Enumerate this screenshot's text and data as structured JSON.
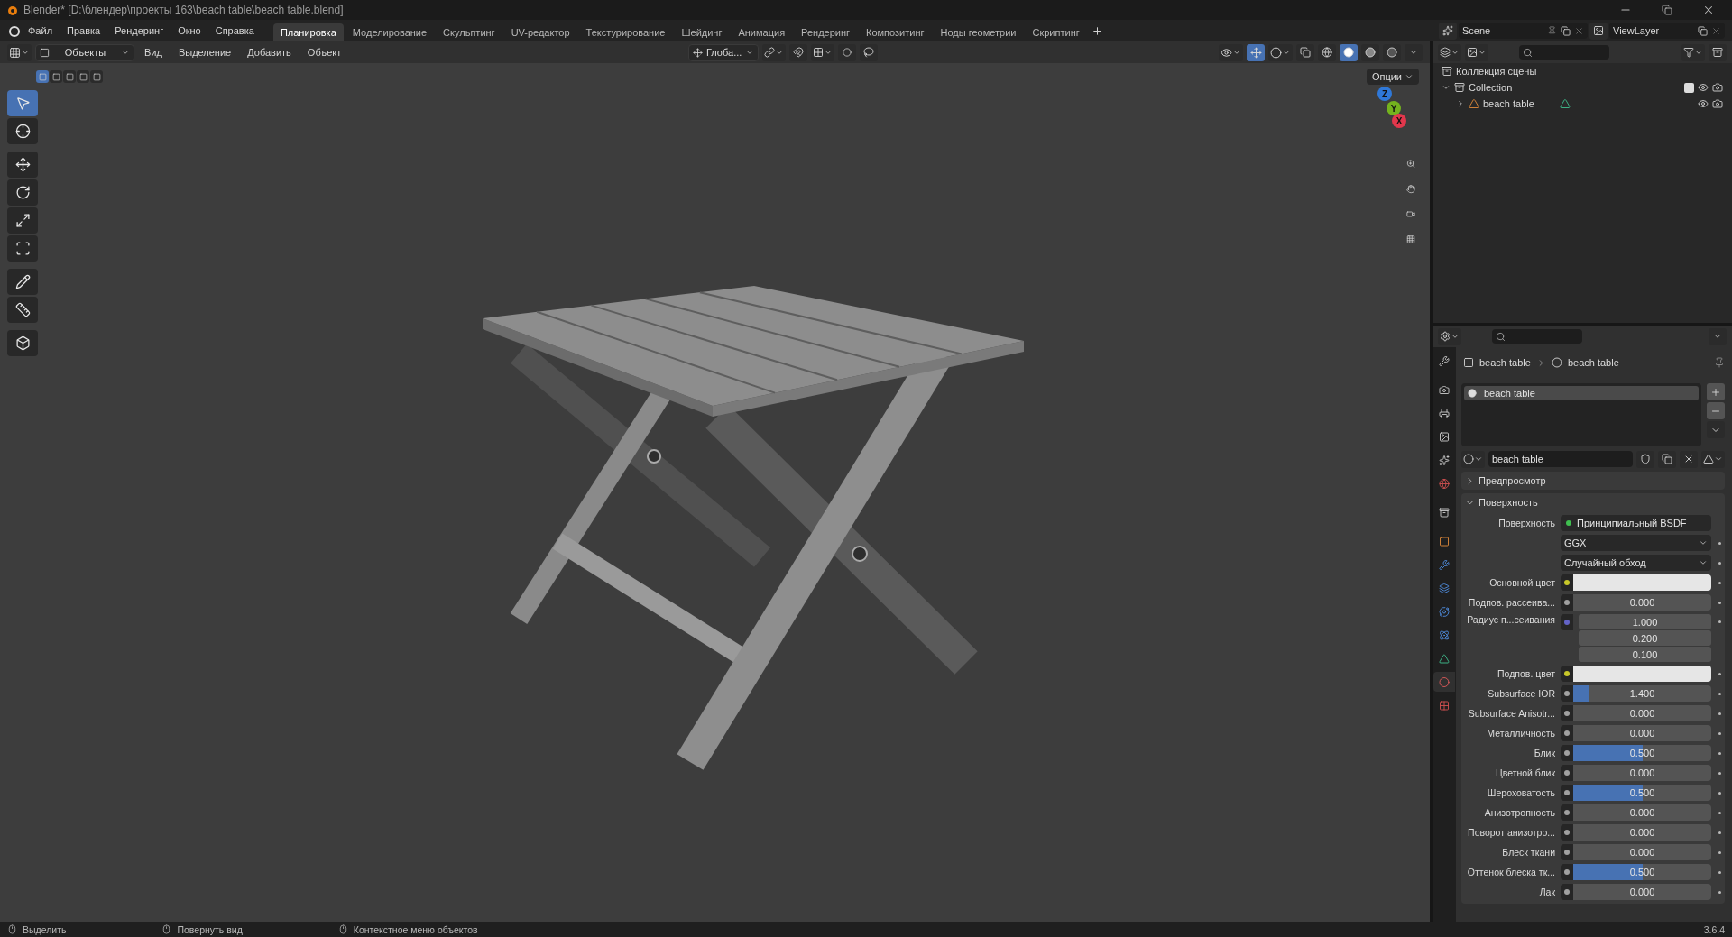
{
  "window": {
    "title": "Blender* [D:\\блендер\\проекты 163\\beach table\\beach table.blend]"
  },
  "menu": [
    "Файл",
    "Правка",
    "Рендеринг",
    "Окно",
    "Справка"
  ],
  "workspaces": [
    {
      "label": "Планировка",
      "selected": true
    },
    {
      "label": "Моделирование",
      "selected": false
    },
    {
      "label": "Скульптинг",
      "selected": false
    },
    {
      "label": "UV-редактор",
      "selected": false
    },
    {
      "label": "Текстурирование",
      "selected": false
    },
    {
      "label": "Шейдинг",
      "selected": false
    },
    {
      "label": "Анимация",
      "selected": false
    },
    {
      "label": "Рендеринг",
      "selected": false
    },
    {
      "label": "Композитинг",
      "selected": false
    },
    {
      "label": "Ноды геометрии",
      "selected": false
    },
    {
      "label": "Скриптинг",
      "selected": false
    }
  ],
  "scene": {
    "name": "Scene",
    "view_layer": "ViewLayer"
  },
  "viewport": {
    "mode": "Объекты",
    "menus": [
      "Вид",
      "Выделение",
      "Добавить",
      "Объект"
    ],
    "orientation": "Глоба...",
    "options": "Опции",
    "gizmo_on": true,
    "select_modes": [
      {
        "selected": true
      },
      {
        "selected": false
      },
      {
        "selected": false
      },
      {
        "selected": false
      },
      {
        "selected": false
      }
    ],
    "shading": [
      {
        "kind": "wireframe",
        "selected": false
      },
      {
        "kind": "solid",
        "selected": true
      },
      {
        "kind": "material",
        "selected": false
      },
      {
        "kind": "rendered",
        "selected": false
      }
    ],
    "tools": [
      {
        "kind": "select",
        "selected": true
      },
      {
        "kind": "cursor",
        "selected": false
      },
      {
        "kind": "move",
        "selected": false
      },
      {
        "kind": "rotate",
        "selected": false
      },
      {
        "kind": "scale",
        "selected": false
      },
      {
        "kind": "transform",
        "selected": false
      },
      {
        "kind": "annotate",
        "selected": false
      },
      {
        "kind": "measure",
        "selected": false
      },
      {
        "kind": "add_cube",
        "selected": false
      }
    ],
    "axes": [
      {
        "label": "Z",
        "color": "#2f78d8"
      },
      {
        "label": "Y",
        "color": "#74b21e"
      },
      {
        "label": "X",
        "color": "#e2374c"
      }
    ]
  },
  "outliner": {
    "root": "Коллекция сцены",
    "children": [
      {
        "label": "Collection",
        "expanded": true,
        "checked": true,
        "children": [
          {
            "label": "beach table",
            "expanded": false
          }
        ]
      }
    ]
  },
  "properties": {
    "breadcrumb": [
      "beach table",
      "beach table"
    ],
    "tabs": [
      {
        "kind": "tool",
        "selected": false
      },
      {
        "kind": "render",
        "selected": false
      },
      {
        "kind": "output",
        "selected": false
      },
      {
        "kind": "view_layer",
        "selected": false
      },
      {
        "kind": "scene",
        "selected": false
      },
      {
        "kind": "world",
        "selected": false
      },
      {
        "kind": "collection",
        "selected": false
      },
      {
        "kind": "object",
        "selected": false
      },
      {
        "kind": "modifiers",
        "selected": false
      },
      {
        "kind": "particles",
        "selected": false
      },
      {
        "kind": "physics",
        "selected": false
      },
      {
        "kind": "constraints",
        "selected": false
      },
      {
        "kind": "data",
        "selected": false
      },
      {
        "kind": "material",
        "selected": true
      },
      {
        "kind": "texture",
        "selected": false
      }
    ],
    "slots": [
      {
        "label": "beach table",
        "selected": true
      }
    ],
    "material_name": "beach table",
    "panels": [
      {
        "label": "Предпросмотр",
        "expanded": false
      },
      {
        "label": "Поверхность",
        "expanded": true
      }
    ],
    "fields": [
      {
        "kind": "shader",
        "label": "Поверхность",
        "value": "Принципиальный BSDF",
        "socket": {
          "color": "#3fbf4f"
        }
      },
      {
        "kind": "dropdown",
        "value": "GGX"
      },
      {
        "kind": "dropdown",
        "value": "Случайный обход"
      },
      {
        "kind": "color",
        "label": "Основной цвет",
        "color": "#e6e6e6",
        "socket": {
          "color": "#c8c82a"
        }
      },
      {
        "kind": "slider",
        "label": "Подпов. рассеива...",
        "value": "0.000",
        "level": 0,
        "socket": {
          "color": "#a1a1a1"
        }
      },
      {
        "kind": "vector",
        "label": "Радиус п...сеивания",
        "values": [
          "1.000",
          "0.200",
          "0.100"
        ],
        "socket": {
          "color": "#6363c7"
        }
      },
      {
        "kind": "color",
        "label": "Подпов. цвет",
        "color": "#e6e6e6",
        "socket": {
          "color": "#c8c82a"
        }
      },
      {
        "kind": "slider",
        "label": "Subsurface IOR",
        "value": "1.400",
        "level": 0.12,
        "socket": {
          "color": "#a1a1a1"
        }
      },
      {
        "kind": "slider",
        "label": "Subsurface Anisotr...",
        "value": "0.000",
        "level": 0,
        "socket": {
          "color": "#a1a1a1"
        }
      },
      {
        "kind": "slider",
        "label": "Металличность",
        "value": "0.000",
        "level": 0,
        "socket": {
          "color": "#a1a1a1"
        }
      },
      {
        "kind": "slider",
        "label": "Блик",
        "value": "0.500",
        "level": 0.5,
        "socket": {
          "color": "#a1a1a1"
        }
      },
      {
        "kind": "slider",
        "label": "Цветной блик",
        "value": "0.000",
        "level": 0,
        "socket": {
          "color": "#a1a1a1"
        }
      },
      {
        "kind": "slider",
        "label": "Шероховатость",
        "value": "0.500",
        "level": 0.5,
        "socket": {
          "color": "#a1a1a1"
        }
      },
      {
        "kind": "slider",
        "label": "Анизотропность",
        "value": "0.000",
        "level": 0,
        "socket": {
          "color": "#a1a1a1"
        }
      },
      {
        "kind": "slider",
        "label": "Поворот анизотро...",
        "value": "0.000",
        "level": 0,
        "socket": {
          "color": "#a1a1a1"
        }
      },
      {
        "kind": "slider",
        "label": "Блеск ткани",
        "value": "0.000",
        "level": 0,
        "socket": {
          "color": "#a1a1a1"
        }
      },
      {
        "kind": "slider",
        "label": "Оттенок блеска тк...",
        "value": "0.500",
        "level": 0.5,
        "socket": {
          "color": "#a1a1a1"
        }
      },
      {
        "kind": "slider",
        "label": "Лак",
        "value": "0.000",
        "level": 0,
        "socket": {
          "color": "#a1a1a1"
        }
      }
    ]
  },
  "status_bar": {
    "hints": [
      "Выделить",
      "Повернуть вид",
      "Контекстное меню объектов"
    ],
    "version": "3.6.4"
  }
}
